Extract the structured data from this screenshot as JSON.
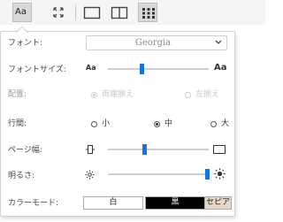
{
  "toolbar": {
    "buttons": [
      {
        "name": "text-settings-icon",
        "label": "Aa",
        "active": true
      },
      {
        "name": "fullscreen-icon",
        "active": false
      },
      {
        "name": "single-page-icon",
        "active": false
      },
      {
        "name": "two-page-icon",
        "active": false
      },
      {
        "name": "thumbnails-icon",
        "active": true
      }
    ]
  },
  "settings": {
    "font": {
      "label": "フォント:",
      "value": "Georgia"
    },
    "font_size": {
      "label": "フォントサイズ:",
      "small_icon": "Aa",
      "large_icon": "Aa",
      "value": 0.33
    },
    "alignment": {
      "label": "配置:",
      "options": [
        "両端揃え",
        "左揃え"
      ],
      "selected": "両端揃え",
      "disabled": true
    },
    "line_spacing": {
      "label": "行間:",
      "options": [
        "小",
        "中",
        "大"
      ],
      "selected": "中"
    },
    "page_width": {
      "label": "ページ幅:",
      "value": 0.35
    },
    "brightness": {
      "label": "明るさ:",
      "value": 1.0
    },
    "color_mode": {
      "label": "カラーモード:",
      "options": [
        {
          "label": "白",
          "bg": "#ffffff",
          "fg": "#222222"
        },
        {
          "label": "黒",
          "bg": "#000000",
          "fg": "#ffffff"
        },
        {
          "label": "セピア",
          "bg": "#e7d8c6",
          "fg": "#222222"
        }
      ]
    }
  }
}
